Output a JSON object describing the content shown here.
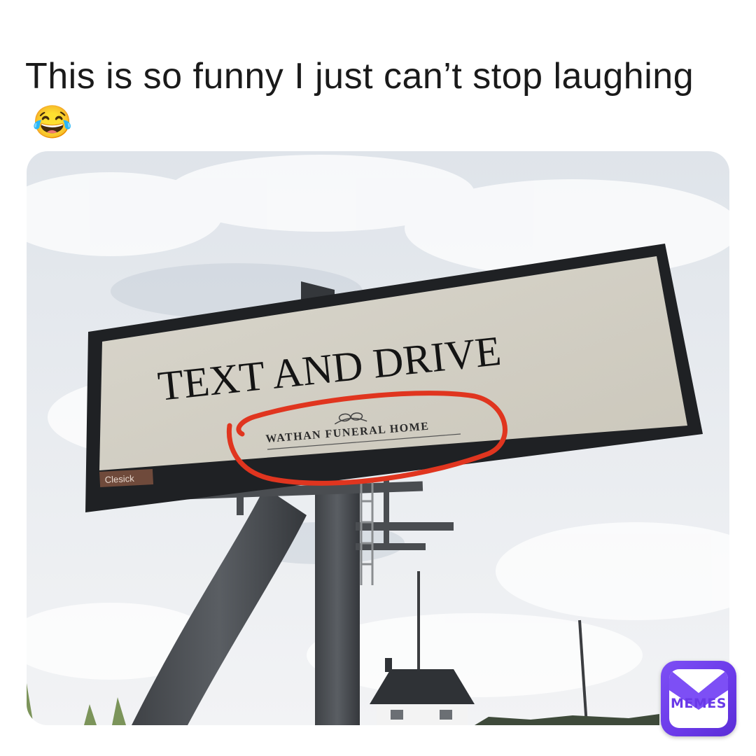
{
  "caption": {
    "text": "This is so funny I just can’t stop laughing",
    "emoji": "😂"
  },
  "billboard": {
    "headline": "TEXT AND DRIVE",
    "sponsor": "WATHAN FUNERAL HOME",
    "operator_tag": "Clesick"
  },
  "badge": {
    "label": "MEMES",
    "icon": "envelope-icon",
    "color": "#6a39e8"
  },
  "annotation": {
    "color": "#e0351f",
    "shape": "hand-drawn circle"
  }
}
